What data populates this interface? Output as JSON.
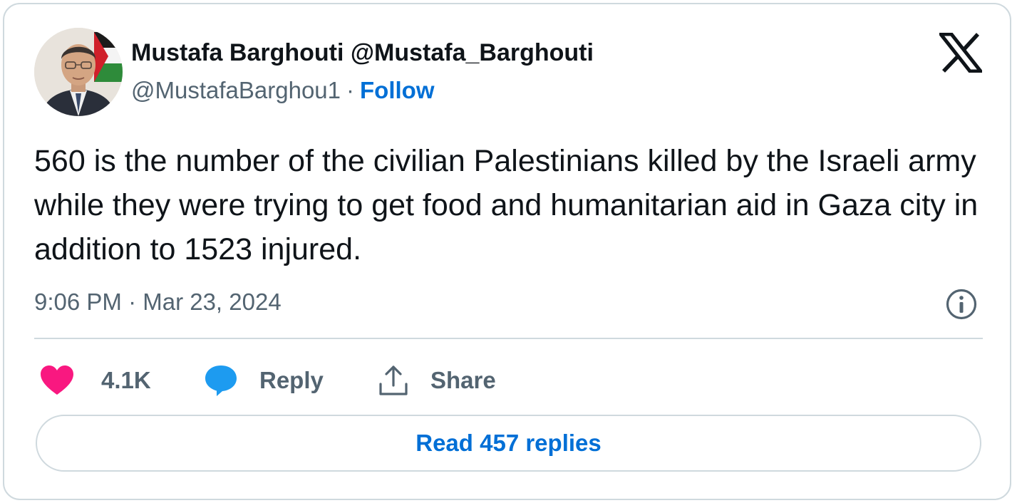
{
  "tweet": {
    "author": {
      "display_name": "Mustafa Barghouti @Mustafa_Barghouti",
      "handle": "@MustafaBarghou1",
      "separator": "·",
      "follow_label": "Follow",
      "avatar": "profile-photo"
    },
    "brand_icon": "x-logo-icon",
    "text": "560 is the number of the civilian Palestinians killed by the Israeli army while they were trying to get food and humanitarian aid in Gaza city in addition to 1523 injured.",
    "timestamp": "9:06 PM · Mar 23, 2024",
    "info_icon": "info-icon",
    "actions": {
      "like": {
        "icon": "heart-icon",
        "count": "4.1K"
      },
      "reply": {
        "icon": "speech-bubble-icon",
        "label": "Reply"
      },
      "share": {
        "icon": "share-upload-icon",
        "label": "Share"
      }
    },
    "read_replies_label": "Read 457 replies"
  },
  "colors": {
    "text_primary": "#0f1419",
    "text_secondary": "#536471",
    "link_blue": "#006fd6",
    "like_pink": "#f91880",
    "reply_blue": "#1d9bf0",
    "border": "#cfd9de"
  }
}
